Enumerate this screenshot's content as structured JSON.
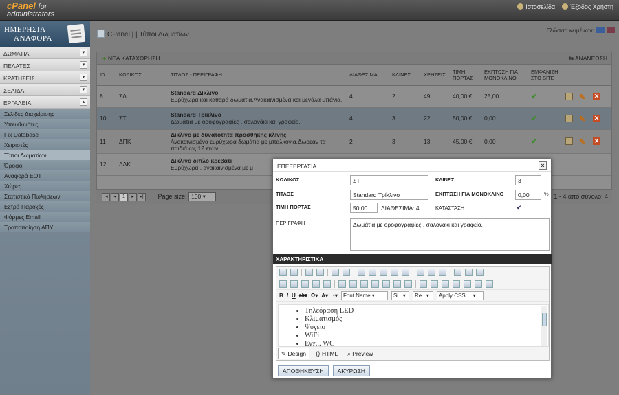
{
  "app": {
    "logo_line1": "cPanel",
    "logo_for": "for",
    "logo_line2": "administrators"
  },
  "toplinks": {
    "site": "Ιστοσελίδα",
    "logout": "Έξοδος Χρήστη"
  },
  "sidebar": {
    "title1": "ΗΜΕΡΗΣΙΑ",
    "title2": "ΑΝΑΦΟΡΑ",
    "groups": [
      "ΔΩΜΑΤΙΑ",
      "ΠΕΛΑΤΕΣ",
      "ΚΡΑΤΗΣΕΙΣ",
      "ΣΕΛΙΔΑ",
      "ΕΡΓΑΛΕΙΑ"
    ],
    "items": [
      "Σελίδες Διαχείρισης",
      "Υπευθυνότες",
      "Fix Database",
      "Χειριστές",
      "Τύποι Δωματίων",
      "Όροφοι",
      "Αναφορά ΕΟΤ",
      "Χώρες",
      "Στατιστικά Πωλήσεων",
      "Εξτρά Παροχές",
      "Φόρμες Email",
      "Τροποποίηση ΑΠΥ"
    ]
  },
  "breadcrumb": "CPanel | | Τύποι Δωματίων",
  "lang_label": "Γλώσσα κειμένων:",
  "grid": {
    "new_entry": "ΝΕΑ ΚΑΤΑΧΩΡΗΣΗ",
    "refresh": "ΑΝΑΝΕΩΣΗ",
    "headers": [
      "ID",
      "ΚΩΔΙΚΟΣ",
      "ΤΙΤΛΟΣ - ΠΕΡΙΓΡΑΦΗ",
      "ΔΙΑΘΕΣΙΜΑ:",
      "ΚΛΙΝΕΣ",
      "ΧΡΗΣΕΙΣ",
      "ΤΙΜΗ ΠΟΡΤΑΣ",
      "ΕΚΠΤΩΣΗ ΓΙΑ ΜΟΝΟΚΛΙΝΟ",
      "ΕΜΦΑΝΙΣΗ ΣΤΟ SITE"
    ],
    "rows": [
      {
        "id": "8",
        "code": "ΣΔ",
        "title": "Standard Δίκλινο",
        "desc": "Ευρύχωρα και καθαρά δωμάτια.Ανακαινισμένα και μεγάλα μπάνια.",
        "avail": "4",
        "beds": "2",
        "uses": "49",
        "price": "40,00 €",
        "discount": "25,00"
      },
      {
        "id": "10",
        "code": "ΣΤ",
        "title": "Standard Τρίκλινο",
        "desc": "Δωμάτια με ορoφογραφίες , σαλονάκι και γραφείο.",
        "avail": "4",
        "beds": "3",
        "uses": "22",
        "price": "50,00 €",
        "discount": "0,00"
      },
      {
        "id": "11",
        "code": "ΔΠΚ",
        "title": "Δίκλινο με δυνατότητα προσθήκης κλίνης",
        "desc": "Ανακαινισμένα ευρύχωρα δωμάτια με μπαλκόνια.Δωρεάν τα παιδιά ως 12 ετών.",
        "avail": "2",
        "beds": "3",
        "uses": "13",
        "price": "45,00 €",
        "discount": "0,00"
      },
      {
        "id": "12",
        "code": "ΔΔΚ",
        "title": "Δίκλινο διπλό κρεβάτι",
        "desc": "Ευρύχωρα , ανακαινισμένα με μ",
        "avail": "",
        "beds": "",
        "uses": "",
        "price": "",
        "discount": ""
      }
    ],
    "page_size_label": "Page size:",
    "page_size": "100",
    "page_num": "1",
    "page_info": "1 - 4 από σύνολο: 4"
  },
  "modal": {
    "title": "ΕΠΕΞΕΡΓΑΣΙΑ",
    "code_label": "ΚΩΔΙΚΟΣ",
    "code": "ΣΤ",
    "beds_label": "ΚΛΙΝΕΣ",
    "beds": "3",
    "title_label": "ΤΙΤΛΟΣ",
    "title_value": "Standard Τρίκλινο",
    "discount_label": "ΕΚΠΤΩΣΗ ΓΙΑ ΜΟΝΟΚΛΙΝΟ",
    "discount": "0,00",
    "percent": "%",
    "price_label": "ΤΙΜΗ ΠΟΡΤΑΣ",
    "price": "50,00",
    "avail_text": "ΔΙΑΘΕΣΙΜΑ: 4",
    "status_label": "ΚΑΤΑΣΤΑΣΗ",
    "status_check": "✔",
    "desc_label": "ΠΕΡΙΓΡΑΦΗ",
    "desc": "Δωμάτια με ορoφογραφίες , σαλονάκι και γραφείο.",
    "features_label": "ΧΑΡΑΚΤΗΡΙΣΤΙΚΑ",
    "editor": {
      "font": "Font Name",
      "size": "Si...",
      "format": "Re...",
      "css": "Apply CSS ...",
      "items": [
        "Τηλεόραση LED",
        "Κλιματισμός",
        "Ψυγείο",
        "WiFi",
        "Εγχ... WC"
      ],
      "tabs": [
        "Design",
        "HTML",
        "Preview"
      ]
    },
    "save": "ΑΠΟΘΗΚΕΥΣΗ",
    "cancel": "ΑΚΥΡΩΣΗ"
  }
}
